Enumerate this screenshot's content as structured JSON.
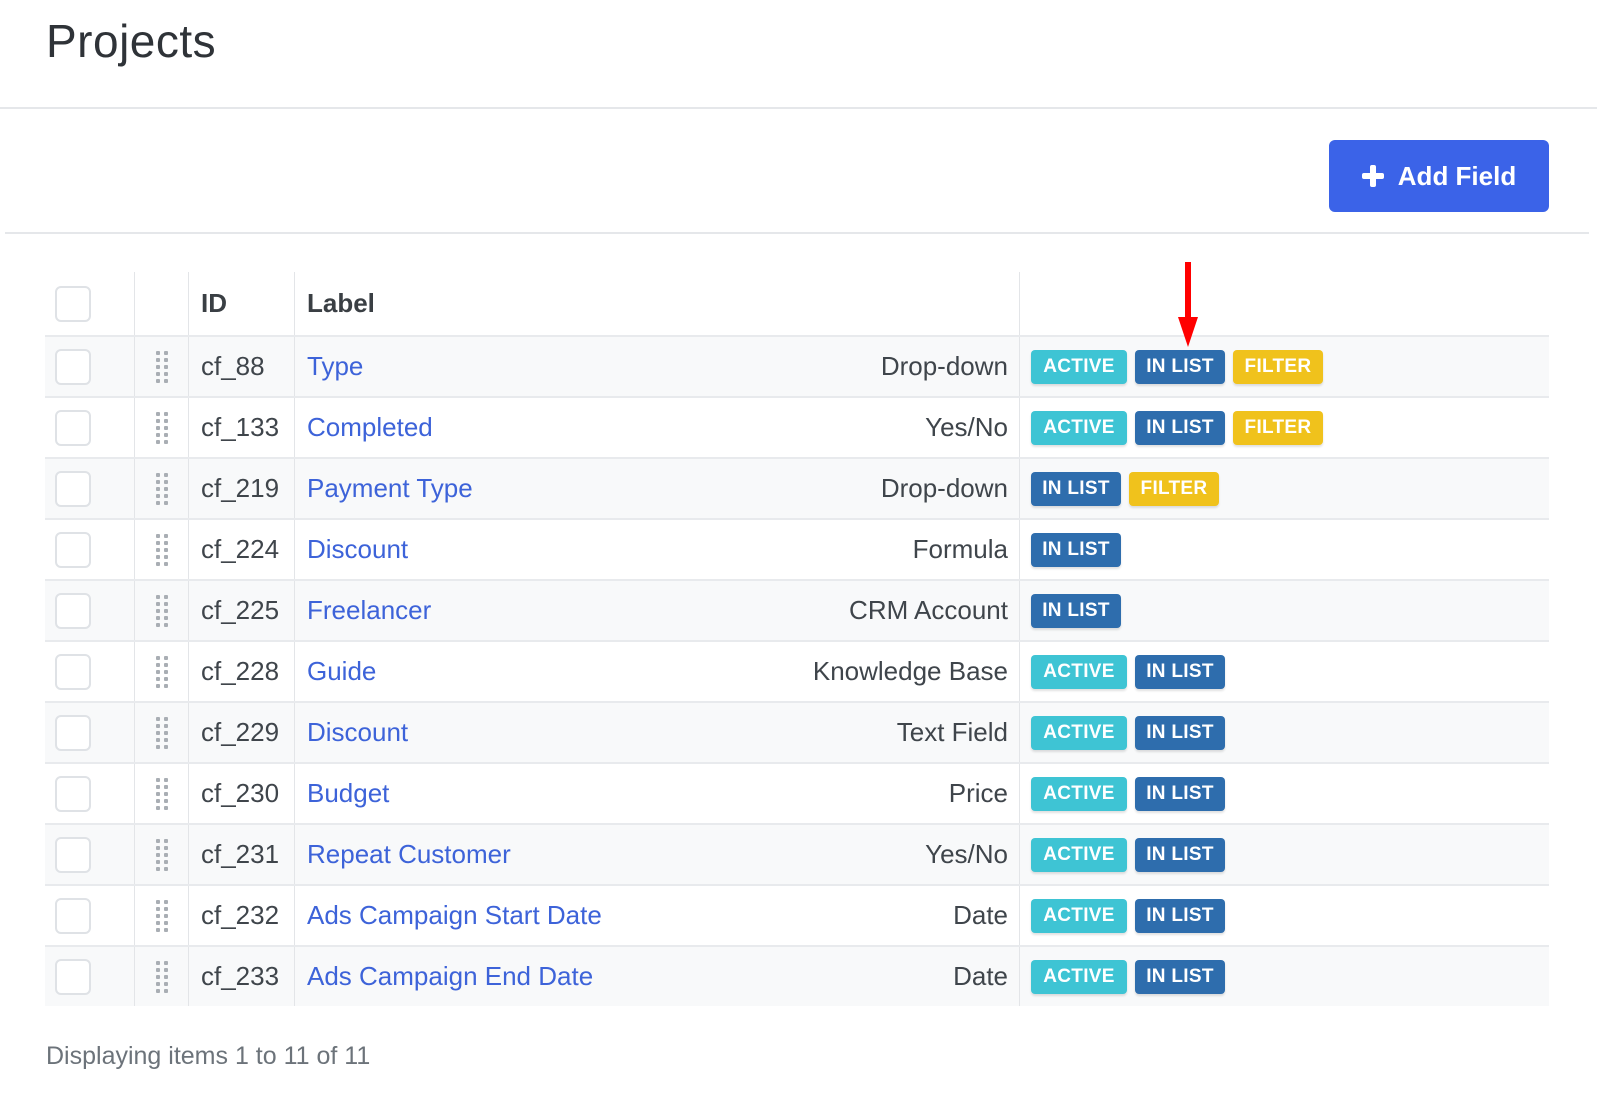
{
  "page": {
    "title": "Projects"
  },
  "toolbar": {
    "add_field_label": "Add Field"
  },
  "table": {
    "headers": {
      "id": "ID",
      "label": "Label"
    },
    "rows": [
      {
        "id": "cf_88",
        "label": "Type",
        "type": "Drop-down",
        "badges": [
          "ACTIVE",
          "IN LIST",
          "FILTER"
        ]
      },
      {
        "id": "cf_133",
        "label": "Completed",
        "type": "Yes/No",
        "badges": [
          "ACTIVE",
          "IN LIST",
          "FILTER"
        ]
      },
      {
        "id": "cf_219",
        "label": "Payment Type",
        "type": "Drop-down",
        "badges": [
          "IN LIST",
          "FILTER"
        ]
      },
      {
        "id": "cf_224",
        "label": "Discount",
        "type": "Formula",
        "badges": [
          "IN LIST"
        ]
      },
      {
        "id": "cf_225",
        "label": "Freelancer",
        "type": "CRM Account",
        "badges": [
          "IN LIST"
        ]
      },
      {
        "id": "cf_228",
        "label": "Guide",
        "type": "Knowledge Base",
        "badges": [
          "ACTIVE",
          "IN LIST"
        ]
      },
      {
        "id": "cf_229",
        "label": "Discount",
        "type": "Text Field",
        "badges": [
          "ACTIVE",
          "IN LIST"
        ]
      },
      {
        "id": "cf_230",
        "label": "Budget",
        "type": "Price",
        "badges": [
          "ACTIVE",
          "IN LIST"
        ]
      },
      {
        "id": "cf_231",
        "label": "Repeat Customer",
        "type": "Yes/No",
        "badges": [
          "ACTIVE",
          "IN LIST"
        ]
      },
      {
        "id": "cf_232",
        "label": "Ads Campaign Start Date",
        "type": "Date",
        "badges": [
          "ACTIVE",
          "IN LIST"
        ]
      },
      {
        "id": "cf_233",
        "label": "Ads Campaign End Date",
        "type": "Date",
        "badges": [
          "ACTIVE",
          "IN LIST"
        ]
      }
    ]
  },
  "footer": {
    "summary": "Displaying items 1 to 11 of 11"
  },
  "colors": {
    "primary": "#3b63e8",
    "link": "#3d63d9",
    "badge_active": "#3ec4d4",
    "badge_in_list": "#2e6dad",
    "badge_filter": "#f0c21c",
    "annotation_arrow": "#ff0000"
  },
  "icons": {
    "add": "plus-icon",
    "drag": "drag-handle-icon",
    "annotation": "red-arrow-icon"
  }
}
